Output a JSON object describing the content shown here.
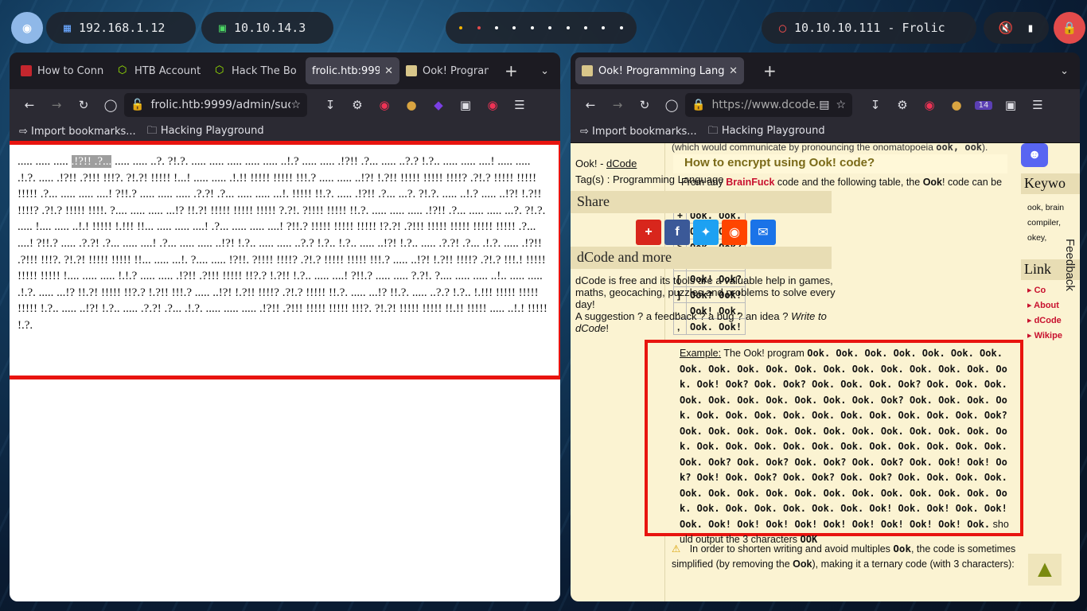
{
  "topbar": {
    "ip_local": "192.168.1.12",
    "ip_vpn": "10.10.14.3",
    "target": "10.10.10.111 - Frolic"
  },
  "left_window": {
    "tabs": [
      {
        "label": "How to Conn",
        "icon": "htb-red-icon"
      },
      {
        "label": "HTB Account",
        "icon": "htb-cube-icon"
      },
      {
        "label": "Hack The Bo",
        "icon": "htb-cube-icon"
      },
      {
        "label": "frolic.htb:9999",
        "icon": "none"
      },
      {
        "label": "Ook! Program",
        "icon": "dcode-icon"
      }
    ],
    "url": "frolic.htb:9999/admin/suc",
    "bookmarks": [
      "Import bookmarks...",
      "Hacking Playground"
    ],
    "ook_highlight": ".!?!! .?...",
    "ook_before": "..... ..... ..... ",
    "ook_text": " ..... ..... ..?. ?!.?. ..... ..... ..... ..... ..... ..!.? ..... ..... .!?!! .?... ..... ..?.? !.?.. ..... ..... ....! ..... ..... .!.?. ..... .!?!! .?!!! !!!?. ?!.?! !!!!! !...! ..... ..... .!.!! !!!!! !!!!! !!!.? ..... ..... ..!?! !.?!! !!!!! !!!!! !!!!? .?!.? !!!!! !!!!! !!!!! .?... ..... ..... ....! ?!!.? ..... ..... ..... .?.?! .?... ..... ..... ...!. !!!!! !!.?. ..... .!?!! .?... ...?. ?!.?. ..... ..!.? ..... ..!?! !.?!! !!!!? .?!.? !!!!! !!!!. ?.... ..... ..... ...!? !!.?! !!!!! !!!!! !!!!! ?.?!. ?!!!! !!!!! !!.?. ..... ..... ..... .!?!! .?... ..... ..... ...?. ?!.?. ..... !.... ..... ..!.! !!!!! !.!!! !!... ..... ..... ....! .?... ..... ..... ....! ?!!.? !!!!! !!!!! !!!!! !?.?! .?!!! !!!!! !!!!! !!!!! !!!!! .?... ....! ?!!.? ..... .?.?! .?... ..... ....! .?... ..... ..... ..!?! !.?.. ..... ..... ..?.? !.?.. !.?.. ..... ..!?! !.?.. ..... .?.?! .?... .!.?. ..... .!?!! .?!!! !!!?. ?!.?! !!!!! !!!!! !!... ..... ...!. ?.... ..... !?!!. ?!!!! !!!!? .?!.? !!!!! !!!!! !!!.? ..... ..!?! !.?!! !!!!? .?!.? !!!.! !!!!! !!!!! !!!!! !.... ..... ..... !.!.? ..... ..... .!?!! .?!!! !!!!! !!?.? !.?!! !.?.. ..... ....! ?!!.? ..... ..... ?.?!. ?.... ..... ..... ..!.. ..... ..... .!.?. ..... ...!? !!.?! !!!!! !!?.? !.?!! !!!.? ..... ..!?! !.?!! !!!!? .?!.? !!!!! !!.?. ..... ...!? !!.?. ..... ..?.? !.?.. !.!!! !!!!! !!!!! !!!!! !.?.. ..... ..!?! !.?.. ..... .?.?! .?... .!.?. ..... ..... ..... .!?!! .?!!! !!!!! !!!!! !!!?. ?!.?! !!!!! !!!!! !!.!! !!!!! ..... ..!.! !!!!! !.?."
  },
  "right_window": {
    "tab": "Ook! Programming Langu",
    "url": "https://www.dcode.fr",
    "badge": "14",
    "bookmarks": [
      "Import bookmarks...",
      "Hacking Playground"
    ],
    "crumb_prefix": "Ook! - ",
    "crumb_link": "dCode",
    "tags": "Tag(s) : Programming Language",
    "share_heading": "Share",
    "more_heading": "dCode and more",
    "more_text": "dCode is free and its tools are a valuable help in games, maths, geocaching, puzzles and problems to solve every day!",
    "suggestion": "A suggestion ? a feedback ? a bug ? an idea ?",
    "write_to": "Write to dCode",
    "top_note": "(which would communicate by pronouncing the onomatopoeia",
    "top_note_code": "ook, ook",
    "encrypt_heading": "How to encrypt using Ook! code?",
    "from_any": "From any",
    "brainfuck": "BrainFuck",
    "from_rest": "code and the following table, the",
    "ook_word": "Ook",
    "code_can": "! code can be",
    "table_rows": [
      {
        "sym": "+",
        "code": "Ook. Ook."
      },
      {
        "sym": "-",
        "code": "Ook! Ook!"
      },
      {
        "sym": ">",
        "code": "Ook. Ook?"
      },
      {
        "sym": "<",
        "code": "Ook? Ook."
      },
      {
        "sym": "[",
        "code": "Ook! Ook?"
      },
      {
        "sym": "]",
        "code": "Ook? Ook!"
      },
      {
        "sym": ".",
        "code": "Ook! Ook."
      },
      {
        "sym": ",",
        "code": "Ook. Ook!"
      }
    ],
    "example_label": "Example:",
    "example_intro": "The Ook! program",
    "example_code": "Ook. Ook. Ook. Ook. Ook. Ook. Ook. Ook. Ook. Ook. Ook. Ook. Ook. Ook. Ook. Ook. Ook. Ook. Ook. Ook! Ook? Ook. Ook? Ook. Ook. Ook. Ook? Ook. Ook. Ook. Ook. Ook. Ook. Ook. Ook. Ook. Ook. Ook? Ook. Ook. Ook. Ook. Ook. Ook. Ook. Ook. Ook. Ook. Ook. Ook. Ook. Ook. Ook? Ook. Ook. Ook. Ook. Ook. Ook. Ook. Ook. Ook. Ook. Ook. Ook. Ook. Ook. Ook. Ook. Ook. Ook. Ook. Ook. Ook. Ook. Ook. Ook. Ook? Ook. Ook? Ook. Ook? Ook. Ook? Ook. Ook! Ook! Ook? Ook! Ook. Ook? Ook. Ook? Ook. Ook? Ook. Ook. Ook. Ook. Ook. Ook. Ook. Ook. Ook. Ook. Ook. Ook. Ook. Ook. Ook. Ook. Ook. Ook. Ook. Ook. Ook. Ook. Ook! Ook. Ook! Ook. Ook! Ook. Ook! Ook! Ook! Ook! Ook! Ook! Ook! Ook! Ook! Ook.",
    "example_out": "should output the 3 characters",
    "example_out_code": "OOK",
    "warn_text": "In order to shorten writing and avoid multiples",
    "warn_code": "Ook",
    "warn_text2": ", the code is sometimes simplified (by removing the",
    "warn_ook": "Ook",
    "warn_text3": "), making it a ternary code (with 3 characters):",
    "keywords_heading": "Keywo",
    "keywords": [
      "ook, brain",
      "compiler,",
      "okey,"
    ],
    "links_heading": "Link",
    "links": [
      "Co",
      "About",
      "dCode",
      "Wikipe"
    ],
    "feedback": "Feedback"
  }
}
